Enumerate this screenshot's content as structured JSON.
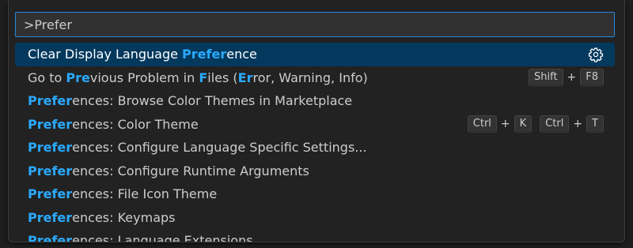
{
  "command_palette": {
    "input_value": ">Prefer",
    "items": [
      {
        "segments": [
          {
            "t": "Clear Display Language ",
            "h": false
          },
          {
            "t": "Prefer",
            "h": true
          },
          {
            "t": "ence",
            "h": false
          }
        ],
        "selected": true,
        "action_icon": "gear-icon"
      },
      {
        "segments": [
          {
            "t": "Go to ",
            "h": false
          },
          {
            "t": "Pre",
            "h": true
          },
          {
            "t": "vious Problem in ",
            "h": false
          },
          {
            "t": "F",
            "h": true
          },
          {
            "t": "iles (",
            "h": false
          },
          {
            "t": "Er",
            "h": true
          },
          {
            "t": "ror, Warning, Info)",
            "h": false
          }
        ],
        "keybinding": [
          [
            "Shift",
            "F8"
          ]
        ]
      },
      {
        "segments": [
          {
            "t": "Prefer",
            "h": true
          },
          {
            "t": "ences: Browse Color Themes in Marketplace",
            "h": false
          }
        ]
      },
      {
        "segments": [
          {
            "t": "Prefer",
            "h": true
          },
          {
            "t": "ences: Color Theme",
            "h": false
          }
        ],
        "keybinding": [
          [
            "Ctrl",
            "K"
          ],
          [
            "Ctrl",
            "T"
          ]
        ]
      },
      {
        "segments": [
          {
            "t": "Prefer",
            "h": true
          },
          {
            "t": "ences: Configure Language Specific Settings...",
            "h": false
          }
        ]
      },
      {
        "segments": [
          {
            "t": "Prefer",
            "h": true
          },
          {
            "t": "ences: Configure Runtime Arguments",
            "h": false
          }
        ]
      },
      {
        "segments": [
          {
            "t": "Prefer",
            "h": true
          },
          {
            "t": "ences: File Icon Theme",
            "h": false
          }
        ]
      },
      {
        "segments": [
          {
            "t": "Prefer",
            "h": true
          },
          {
            "t": "ences: Keymaps",
            "h": false
          }
        ]
      },
      {
        "segments": [
          {
            "t": "Prefer",
            "h": true
          },
          {
            "t": "ences: Language Extensions",
            "h": false
          }
        ]
      }
    ]
  },
  "colors": {
    "highlight": "#2aaaff",
    "selected_background": "#04395e",
    "input_border": "#2488db",
    "text": "#cccccc"
  }
}
